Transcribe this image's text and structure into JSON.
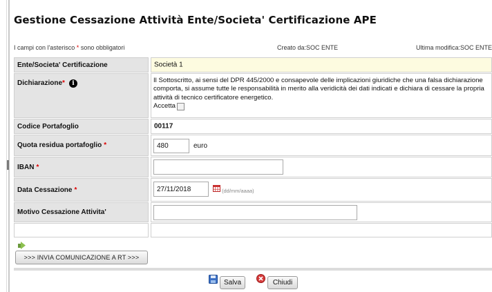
{
  "page": {
    "title": "Gestione Cessazione Attività Ente/Societa' Certificazione APE"
  },
  "infobar": {
    "required_prefix": "I campi con l'asterisco",
    "required_star": "*",
    "required_suffix": "sono obbligatori",
    "created_by": "Creato da:SOC ENTE",
    "modified_by": "Ultima modifica:SOC ENTE"
  },
  "form": {
    "ente": {
      "label": "Ente/Societa' Certificazione",
      "value": "Società 1"
    },
    "dichiarazione": {
      "label": "Dichiarazione",
      "text": "Il Sottoscritto, ai sensi del DPR 445/2000 e consapevole delle implicazioni giuridiche che una falsa dichiarazione comporta, si assume tutte le responsabilità in merito alla veridicità dei dati indicati e dichiara di cessare la propria attività di tecnico certificatore energetico.",
      "accept_label": "Accetta",
      "accepted": false
    },
    "codice_portafoglio": {
      "label": "Codice Portafoglio",
      "value": "00117"
    },
    "quota": {
      "label": "Quota residua portafoglio",
      "value": "480",
      "unit": "euro"
    },
    "iban": {
      "label": "IBAN",
      "value": ""
    },
    "data_cessazione": {
      "label": "Data Cessazione",
      "value": "27/11/2018",
      "hint": "(dd/mm/aaaa)"
    },
    "motivo": {
      "label": "Motivo Cessazione Attivita'",
      "value": ""
    }
  },
  "actions": {
    "invia_label": ">>> INVIA COMUNICAZIONE A RT >>>",
    "salva_label": "Salva",
    "chiudi_label": "Chiudi"
  },
  "colors": {
    "required_star": "#dd0000",
    "label_bg": "#e4e4e4",
    "highlight_bg": "#fdfbe0"
  },
  "icons": [
    "info-icon",
    "calendar-icon",
    "arrow-icon",
    "save-icon",
    "close-icon"
  ]
}
